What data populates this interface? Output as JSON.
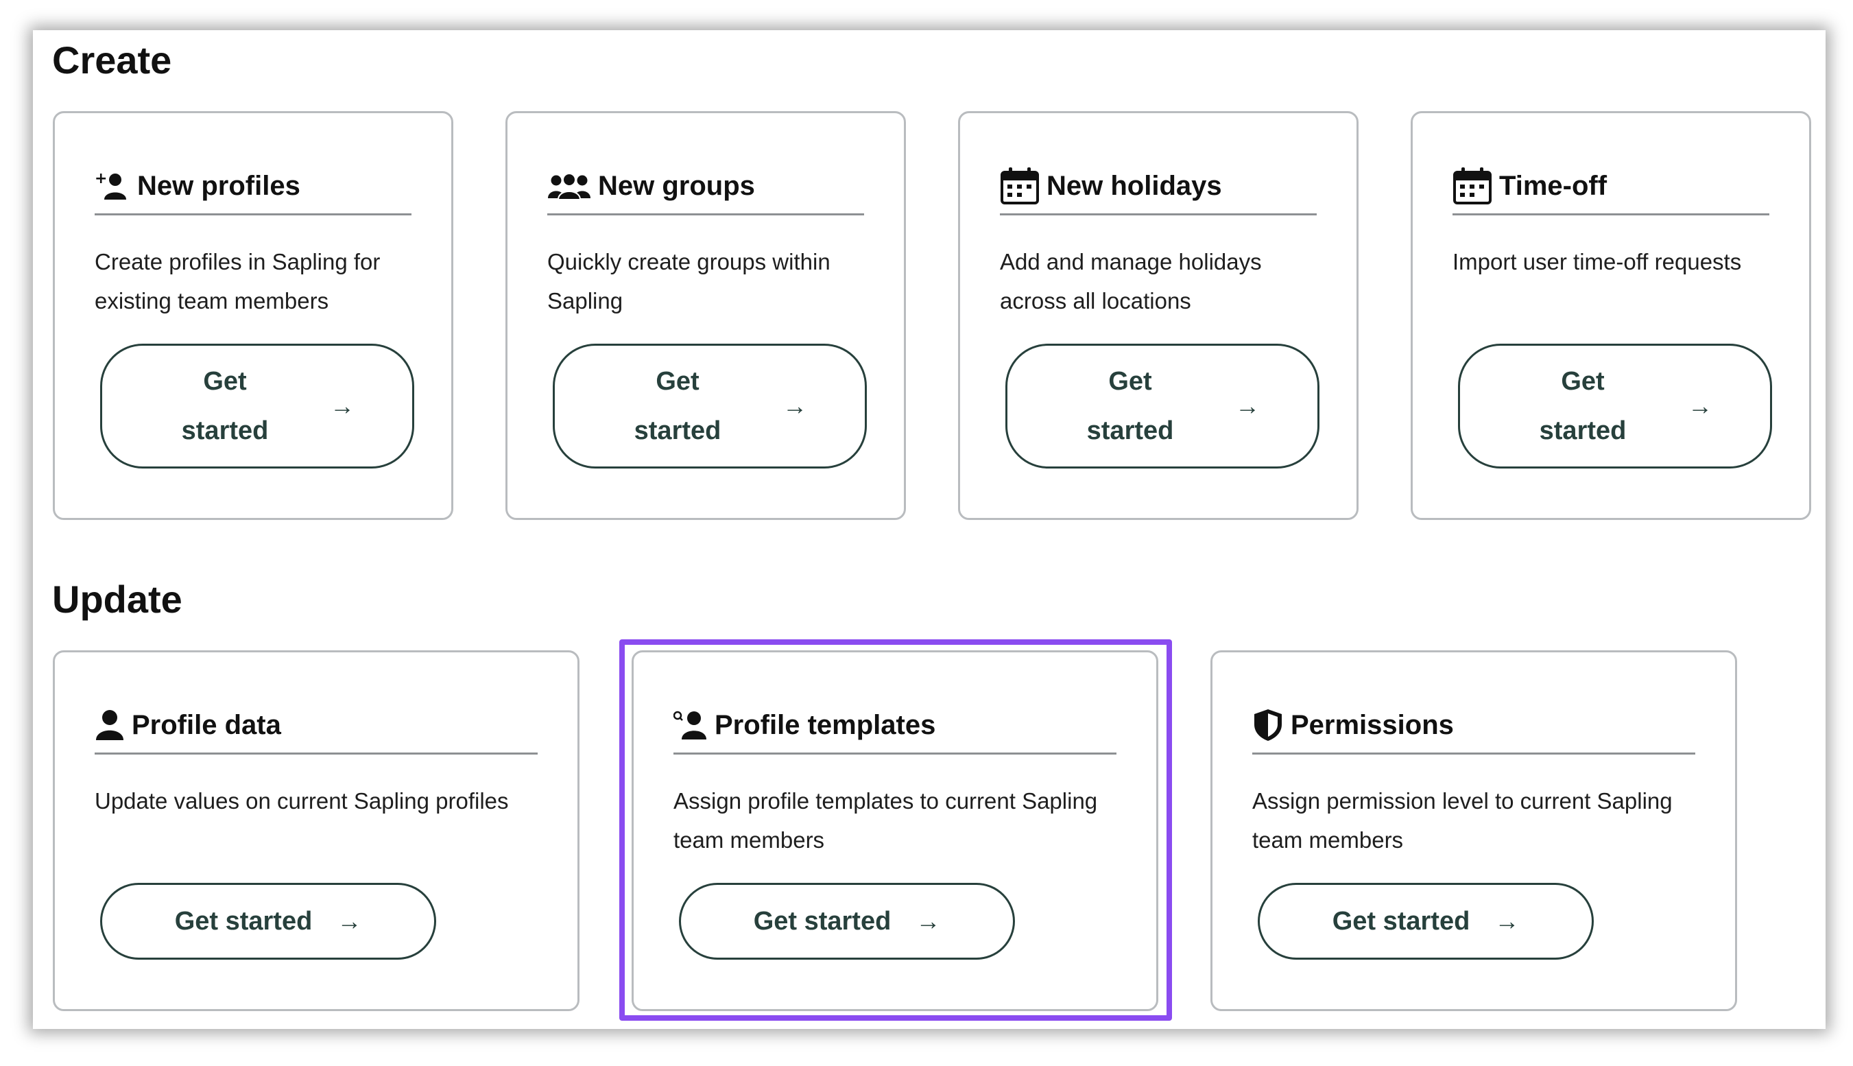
{
  "sections": {
    "create": {
      "title": "Create",
      "cards": [
        {
          "title": "New profiles",
          "icon": "add-user-icon",
          "description": "Create profiles in Sapling for existing team members",
          "button": {
            "label": "Get started",
            "arrow": "→"
          }
        },
        {
          "title": "New groups",
          "icon": "group-icon",
          "description": "Quickly create groups within Sapling",
          "button": {
            "label": "Get started",
            "arrow": "→"
          }
        },
        {
          "title": "New holidays",
          "icon": "calendar-icon",
          "description": "Add and manage holidays across all locations",
          "button": {
            "label": "Get started",
            "arrow": "→"
          }
        },
        {
          "title": "Time-off",
          "icon": "calendar-icon",
          "description": "Import user time-off requests",
          "button": {
            "label": "Get started",
            "arrow": "→"
          }
        }
      ]
    },
    "update": {
      "title": "Update",
      "cards": [
        {
          "title": "Profile data",
          "icon": "user-icon",
          "description": "Update values on current Sapling profiles",
          "button": {
            "label": "Get started",
            "arrow": "→"
          }
        },
        {
          "title": "Profile templates",
          "icon": "user-template-icon",
          "description": "Assign profile templates to current Sapling team members",
          "button": {
            "label": "Get started",
            "arrow": "→"
          }
        },
        {
          "title": "Permissions",
          "icon": "shield-icon",
          "description": "Assign permission level to current Sapling team members",
          "button": {
            "label": "Get started",
            "arrow": "→"
          }
        }
      ]
    }
  },
  "colors": {
    "button_border": "#27403c",
    "button_text": "#27403c",
    "card_border": "#b9bcbf",
    "highlight": "#8a4cf0"
  }
}
